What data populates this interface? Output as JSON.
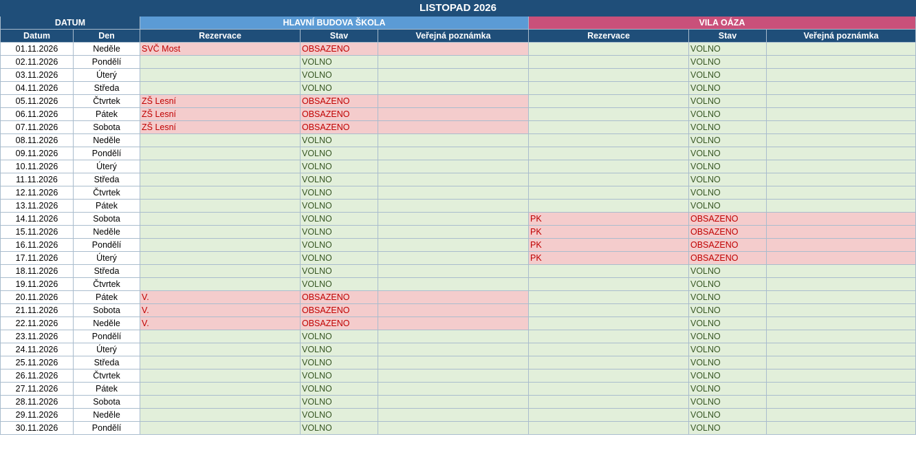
{
  "title": "LISTOPAD 2026",
  "groups": {
    "datum": "DATUM",
    "building_a": "HLAVNÍ BUDOVA ŠKOLA",
    "building_b": "VILA OÁZA"
  },
  "columns": {
    "date": "Datum",
    "day": "Den",
    "a_reservation": "Rezervace",
    "a_status": "Stav",
    "a_note": "Veřejná poznámka",
    "b_reservation": "Rezervace",
    "b_status": "Stav",
    "b_note": "Veřejná poznámka"
  },
  "colors": {
    "header_dark": "#1f4e79",
    "header_blue": "#5b9bd5",
    "header_pink": "#c9507a",
    "free_bg": "#e2efda",
    "busy_bg": "#f4cccc",
    "busy_text": "#c00000",
    "free_text": "#375623"
  },
  "rows": [
    {
      "date": "01.11.2026",
      "day": "Neděle",
      "a_res": "SVČ Most",
      "a_stat": "OBSAZENO",
      "a_note": "",
      "b_res": "",
      "b_stat": "VOLNO",
      "b_note": ""
    },
    {
      "date": "02.11.2026",
      "day": "Pondělí",
      "a_res": "",
      "a_stat": "VOLNO",
      "a_note": "",
      "b_res": "",
      "b_stat": "VOLNO",
      "b_note": ""
    },
    {
      "date": "03.11.2026",
      "day": "Úterý",
      "a_res": "",
      "a_stat": "VOLNO",
      "a_note": "",
      "b_res": "",
      "b_stat": "VOLNO",
      "b_note": ""
    },
    {
      "date": "04.11.2026",
      "day": "Středa",
      "a_res": "",
      "a_stat": "VOLNO",
      "a_note": "",
      "b_res": "",
      "b_stat": "VOLNO",
      "b_note": ""
    },
    {
      "date": "05.11.2026",
      "day": "Čtvrtek",
      "a_res": "ZŠ Lesní",
      "a_stat": "OBSAZENO",
      "a_note": "",
      "b_res": "",
      "b_stat": "VOLNO",
      "b_note": ""
    },
    {
      "date": "06.11.2026",
      "day": "Pátek",
      "a_res": "ZŠ Lesní",
      "a_stat": "OBSAZENO",
      "a_note": "",
      "b_res": "",
      "b_stat": "VOLNO",
      "b_note": ""
    },
    {
      "date": "07.11.2026",
      "day": "Sobota",
      "a_res": "ZŠ Lesní",
      "a_stat": "OBSAZENO",
      "a_note": "",
      "b_res": "",
      "b_stat": "VOLNO",
      "b_note": ""
    },
    {
      "date": "08.11.2026",
      "day": "Neděle",
      "a_res": "",
      "a_stat": "VOLNO",
      "a_note": "",
      "b_res": "",
      "b_stat": "VOLNO",
      "b_note": ""
    },
    {
      "date": "09.11.2026",
      "day": "Pondělí",
      "a_res": "",
      "a_stat": "VOLNO",
      "a_note": "",
      "b_res": "",
      "b_stat": "VOLNO",
      "b_note": ""
    },
    {
      "date": "10.11.2026",
      "day": "Úterý",
      "a_res": "",
      "a_stat": "VOLNO",
      "a_note": "",
      "b_res": "",
      "b_stat": "VOLNO",
      "b_note": ""
    },
    {
      "date": "11.11.2026",
      "day": "Středa",
      "a_res": "",
      "a_stat": "VOLNO",
      "a_note": "",
      "b_res": "",
      "b_stat": "VOLNO",
      "b_note": ""
    },
    {
      "date": "12.11.2026",
      "day": "Čtvrtek",
      "a_res": "",
      "a_stat": "VOLNO",
      "a_note": "",
      "b_res": "",
      "b_stat": "VOLNO",
      "b_note": ""
    },
    {
      "date": "13.11.2026",
      "day": "Pátek",
      "a_res": "",
      "a_stat": "VOLNO",
      "a_note": "",
      "b_res": "",
      "b_stat": "VOLNO",
      "b_note": ""
    },
    {
      "date": "14.11.2026",
      "day": "Sobota",
      "a_res": "",
      "a_stat": "VOLNO",
      "a_note": "",
      "b_res": "PK",
      "b_stat": "OBSAZENO",
      "b_note": ""
    },
    {
      "date": "15.11.2026",
      "day": "Neděle",
      "a_res": "",
      "a_stat": "VOLNO",
      "a_note": "",
      "b_res": "PK",
      "b_stat": "OBSAZENO",
      "b_note": ""
    },
    {
      "date": "16.11.2026",
      "day": "Pondělí",
      "a_res": "",
      "a_stat": "VOLNO",
      "a_note": "",
      "b_res": "PK",
      "b_stat": "OBSAZENO",
      "b_note": ""
    },
    {
      "date": "17.11.2026",
      "day": "Úterý",
      "a_res": "",
      "a_stat": "VOLNO",
      "a_note": "",
      "b_res": "PK",
      "b_stat": "OBSAZENO",
      "b_note": ""
    },
    {
      "date": "18.11.2026",
      "day": "Středa",
      "a_res": "",
      "a_stat": "VOLNO",
      "a_note": "",
      "b_res": "",
      "b_stat": "VOLNO",
      "b_note": ""
    },
    {
      "date": "19.11.2026",
      "day": "Čtvrtek",
      "a_res": "",
      "a_stat": "VOLNO",
      "a_note": "",
      "b_res": "",
      "b_stat": "VOLNO",
      "b_note": ""
    },
    {
      "date": "20.11.2026",
      "day": "Pátek",
      "a_res": "V.",
      "a_stat": "OBSAZENO",
      "a_note": "",
      "b_res": "",
      "b_stat": "VOLNO",
      "b_note": ""
    },
    {
      "date": "21.11.2026",
      "day": "Sobota",
      "a_res": "V.",
      "a_stat": "OBSAZENO",
      "a_note": "",
      "b_res": "",
      "b_stat": "VOLNO",
      "b_note": ""
    },
    {
      "date": "22.11.2026",
      "day": "Neděle",
      "a_res": "V.",
      "a_stat": "OBSAZENO",
      "a_note": "",
      "b_res": "",
      "b_stat": "VOLNO",
      "b_note": ""
    },
    {
      "date": "23.11.2026",
      "day": "Pondělí",
      "a_res": "",
      "a_stat": "VOLNO",
      "a_note": "",
      "b_res": "",
      "b_stat": "VOLNO",
      "b_note": ""
    },
    {
      "date": "24.11.2026",
      "day": "Úterý",
      "a_res": "",
      "a_stat": "VOLNO",
      "a_note": "",
      "b_res": "",
      "b_stat": "VOLNO",
      "b_note": ""
    },
    {
      "date": "25.11.2026",
      "day": "Středa",
      "a_res": "",
      "a_stat": "VOLNO",
      "a_note": "",
      "b_res": "",
      "b_stat": "VOLNO",
      "b_note": ""
    },
    {
      "date": "26.11.2026",
      "day": "Čtvrtek",
      "a_res": "",
      "a_stat": "VOLNO",
      "a_note": "",
      "b_res": "",
      "b_stat": "VOLNO",
      "b_note": ""
    },
    {
      "date": "27.11.2026",
      "day": "Pátek",
      "a_res": "",
      "a_stat": "VOLNO",
      "a_note": "",
      "b_res": "",
      "b_stat": "VOLNO",
      "b_note": ""
    },
    {
      "date": "28.11.2026",
      "day": "Sobota",
      "a_res": "",
      "a_stat": "VOLNO",
      "a_note": "",
      "b_res": "",
      "b_stat": "VOLNO",
      "b_note": ""
    },
    {
      "date": "29.11.2026",
      "day": "Neděle",
      "a_res": "",
      "a_stat": "VOLNO",
      "a_note": "",
      "b_res": "",
      "b_stat": "VOLNO",
      "b_note": ""
    },
    {
      "date": "30.11.2026",
      "day": "Pondělí",
      "a_res": "",
      "a_stat": "VOLNO",
      "a_note": "",
      "b_res": "",
      "b_stat": "VOLNO",
      "b_note": ""
    }
  ]
}
